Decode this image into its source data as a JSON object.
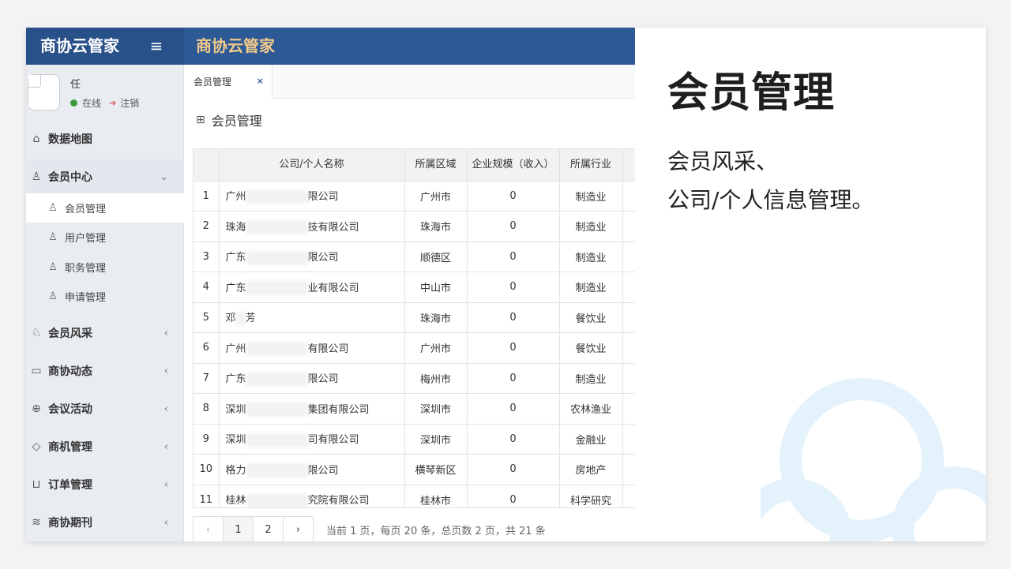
{
  "app": {
    "brand": "商协云管家",
    "header_title": "商协云管家",
    "menu_icon": "hamburger-icon"
  },
  "user": {
    "name": "任",
    "status": "在线",
    "logout": "注销"
  },
  "sidebar": {
    "items": [
      {
        "label": "数据地图",
        "icon": "home-icon"
      },
      {
        "label": "会员中心",
        "icon": "users-icon"
      },
      {
        "label": "会员风采",
        "icon": "award-icon"
      },
      {
        "label": "商协动态",
        "icon": "message-icon"
      },
      {
        "label": "会议活动",
        "icon": "globe-icon"
      },
      {
        "label": "商机管理",
        "icon": "diamond-icon"
      },
      {
        "label": "订单管理",
        "icon": "cart-icon"
      },
      {
        "label": "商协期刊",
        "icon": "layers-icon"
      }
    ],
    "subitems": [
      {
        "label": "会员管理"
      },
      {
        "label": "用户管理"
      },
      {
        "label": "职务管理"
      },
      {
        "label": "申请管理"
      }
    ]
  },
  "tab": {
    "label": "会员管理",
    "close": "×"
  },
  "panel": {
    "title": "会员管理"
  },
  "table": {
    "headers": [
      "",
      "公司/个人名称",
      "所属区域",
      "企业规模（收入）",
      "所属行业"
    ],
    "rows": [
      {
        "no": "1",
        "name_a": "广州",
        "name_b": "限公司",
        "region": "广州市",
        "size": "0",
        "industry": "制造业"
      },
      {
        "no": "2",
        "name_a": "珠海",
        "name_b": "技有限公司",
        "region": "珠海市",
        "size": "0",
        "industry": "制造业"
      },
      {
        "no": "3",
        "name_a": "广东",
        "name_b": "限公司",
        "region": "顺德区",
        "size": "0",
        "industry": "制造业"
      },
      {
        "no": "4",
        "name_a": "广东",
        "name_b": "业有限公司",
        "region": "中山市",
        "size": "0",
        "industry": "制造业"
      },
      {
        "no": "5",
        "name_a": "邓",
        "name_b": "芳",
        "region": "珠海市",
        "size": "0",
        "industry": "餐饮业"
      },
      {
        "no": "6",
        "name_a": "广州",
        "name_b": "有限公司",
        "region": "广州市",
        "size": "0",
        "industry": "餐饮业"
      },
      {
        "no": "7",
        "name_a": "广东",
        "name_b": "限公司",
        "region": "梅州市",
        "size": "0",
        "industry": "制造业"
      },
      {
        "no": "8",
        "name_a": "深圳",
        "name_b": "集团有限公司",
        "region": "深圳市",
        "size": "0",
        "industry": "农林渔业"
      },
      {
        "no": "9",
        "name_a": "深圳",
        "name_b": "司有限公司",
        "region": "深圳市",
        "size": "0",
        "industry": "金融业"
      },
      {
        "no": "10",
        "name_a": "格力",
        "name_b": "限公司",
        "region": "横琴新区",
        "size": "0",
        "industry": "房地产"
      },
      {
        "no": "11",
        "name_a": "桂林",
        "name_b": "究院有限公司",
        "region": "桂林市",
        "size": "0",
        "industry": "科学研究"
      }
    ]
  },
  "pager": {
    "prev": "‹",
    "pages": [
      "1",
      "2"
    ],
    "next": "›",
    "info": "当前 1 页，每页 20 条，总页数 2 页，共 21 条"
  },
  "promo": {
    "headline": "会员管理",
    "line1": "会员风采、",
    "line2": "公司/个人信息管理。",
    "accent_color": "#e3f2fb"
  }
}
